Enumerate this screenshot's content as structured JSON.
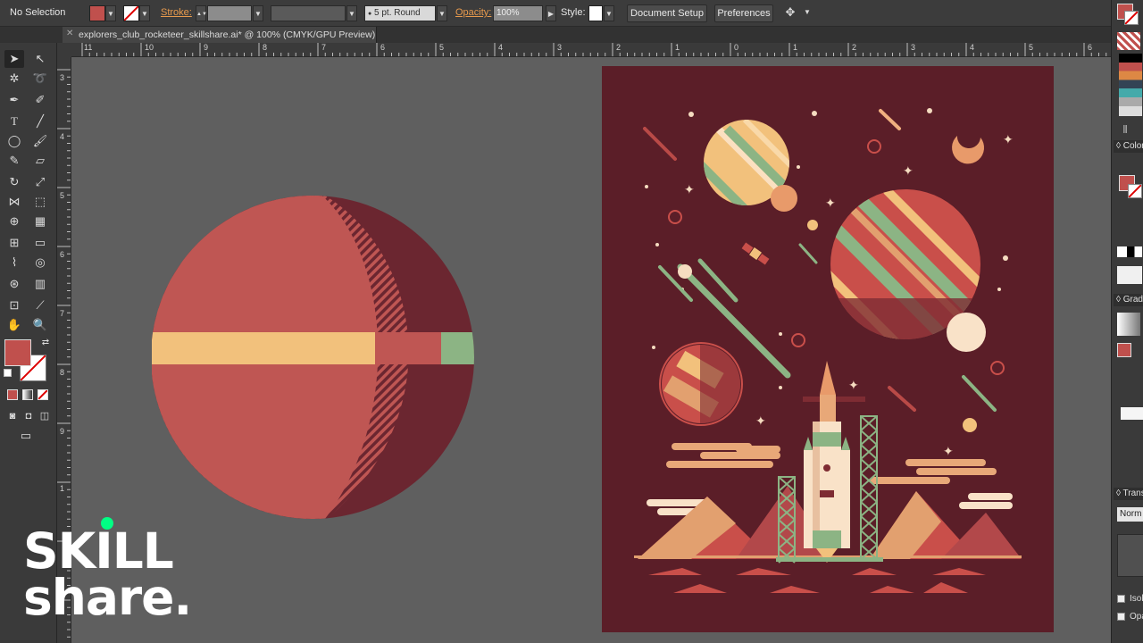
{
  "control_bar": {
    "selection_label": "No Selection",
    "stroke_label": "Stroke:",
    "brush_label": "5 pt. Round",
    "opacity_label": "Opacity:",
    "opacity_value": "100%",
    "style_label": "Style:",
    "document_setup_label": "Document Setup",
    "preferences_label": "Preferences"
  },
  "document": {
    "tab_title": "explorers_club_rocketeer_skillshare.ai* @ 100% (CMYK/GPU Preview)"
  },
  "rulers": {
    "top": [
      "11",
      "10",
      "9",
      "8",
      "7",
      "6",
      "5",
      "4",
      "3",
      "2",
      "1",
      "0",
      "1",
      "2",
      "3",
      "4",
      "5",
      "6"
    ],
    "left": [
      "3",
      "4",
      "5",
      "6",
      "7",
      "8",
      "9",
      "1"
    ]
  },
  "right_panel": {
    "color_header": "Color",
    "gradient_header": "Gradi",
    "transparency_header": "Trans",
    "blend_mode": "Norm",
    "isolate_label": "Isol",
    "opacity_label": "Opa"
  },
  "watermark": {
    "line1": "SKILL",
    "line2": "share."
  },
  "colors": {
    "fill": "#c0504d",
    "planet_red": "#bf5653",
    "planet_dark": "#6b2630",
    "band_yellow": "#f2c17c",
    "band_green": "#8cb484",
    "artboard_bg": "#5b1e28",
    "skillshare_green": "#00ff84"
  }
}
